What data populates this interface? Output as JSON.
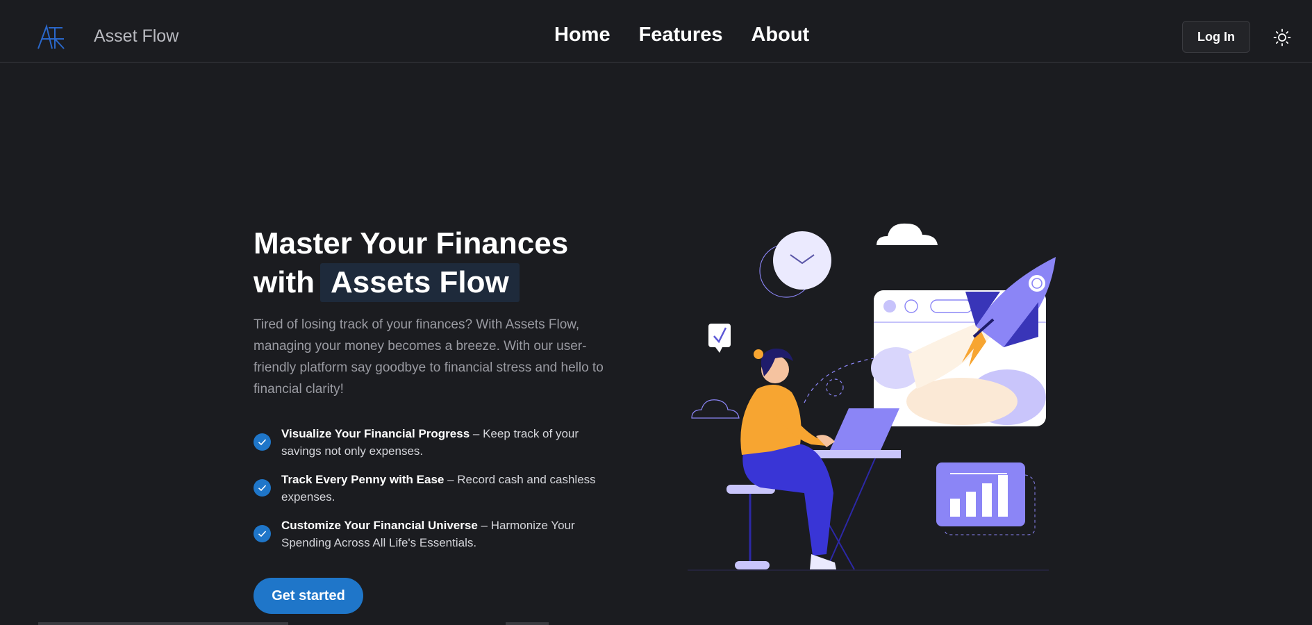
{
  "brand": {
    "name": "Asset Flow",
    "logo_icon": "af-monogram-icon"
  },
  "nav": {
    "links": [
      "Home",
      "Features",
      "About"
    ],
    "login_label": "Log In",
    "theme_toggle_icon": "sun-icon"
  },
  "hero": {
    "title_line1": "Master Your Finances",
    "title_with": "with",
    "title_highlight": "Assets Flow",
    "description": "Tired of losing track of your finances? With Assets Flow, managing your money becomes a breeze. With our user-friendly platform say goodbye to financial stress and hello to financial clarity!",
    "features": [
      {
        "title": "Visualize Your Financial Progress",
        "text": " – Keep track of your savings not only expenses.",
        "icon": "check-circle-icon"
      },
      {
        "title": "Track Every Penny with Ease",
        "text": " – Record cash and cashless expenses.",
        "icon": "check-circle-icon"
      },
      {
        "title": "Customize Your Financial Universe",
        "text": " – Harmonize Your Spending Across All Life's Essentials.",
        "icon": "check-circle-icon"
      }
    ],
    "cta_label": "Get started"
  },
  "colors": {
    "background": "#1b1c20",
    "accent": "#1f76c9",
    "illustration_purple": "#8b85f6",
    "illustration_orange": "#f7a531"
  }
}
